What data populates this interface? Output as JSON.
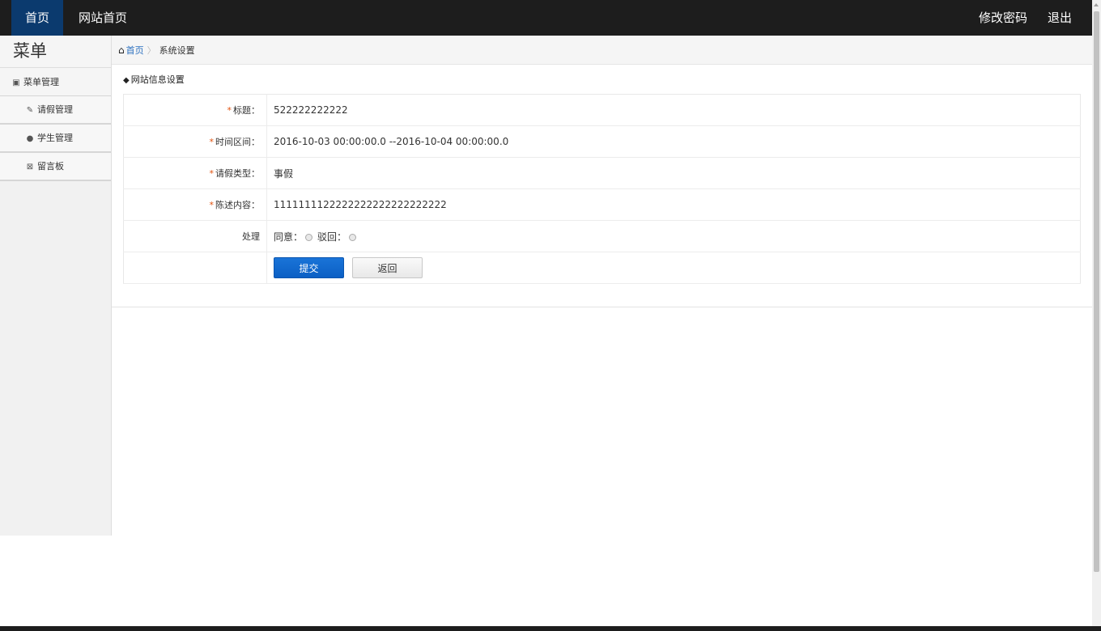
{
  "topbar": {
    "left_items": [
      "首页",
      "网站首页"
    ],
    "right_items": [
      "修改密码",
      "退出"
    ]
  },
  "sidebar": {
    "title": "菜单",
    "group": {
      "label": "菜单管理",
      "icon": "book-icon"
    },
    "items": [
      {
        "label": "请假管理",
        "icon": "wrench-icon"
      },
      {
        "label": "学生管理",
        "icon": "comment-icon"
      },
      {
        "label": "留言板",
        "icon": "envelope-icon"
      }
    ]
  },
  "breadcrumb": {
    "home": "首页",
    "current": "系统设置"
  },
  "panel": {
    "title": "网站信息设置"
  },
  "form": {
    "required_mark": "*",
    "title_label": "标题：",
    "title_value": "522222222222",
    "time_label": "时间区间：",
    "time_value": "2016-10-03 00:00:00.0 --2016-10-04 00:00:00.0",
    "type_label": "请假类型：",
    "type_value": "事假",
    "content_label": "陈述内容：",
    "content_value": "1111111122222222222222222222",
    "process_label": "处理",
    "agree_label": "同意：",
    "reject_label": "驳回：",
    "submit_label": "提交",
    "back_label": "返回"
  },
  "colors": {
    "topbar": "#1d1d1d",
    "active_nav": "#0b3a6e",
    "primary_button": "#0b5fc4",
    "required": "#e0500c",
    "link": "#2a6fbf"
  }
}
